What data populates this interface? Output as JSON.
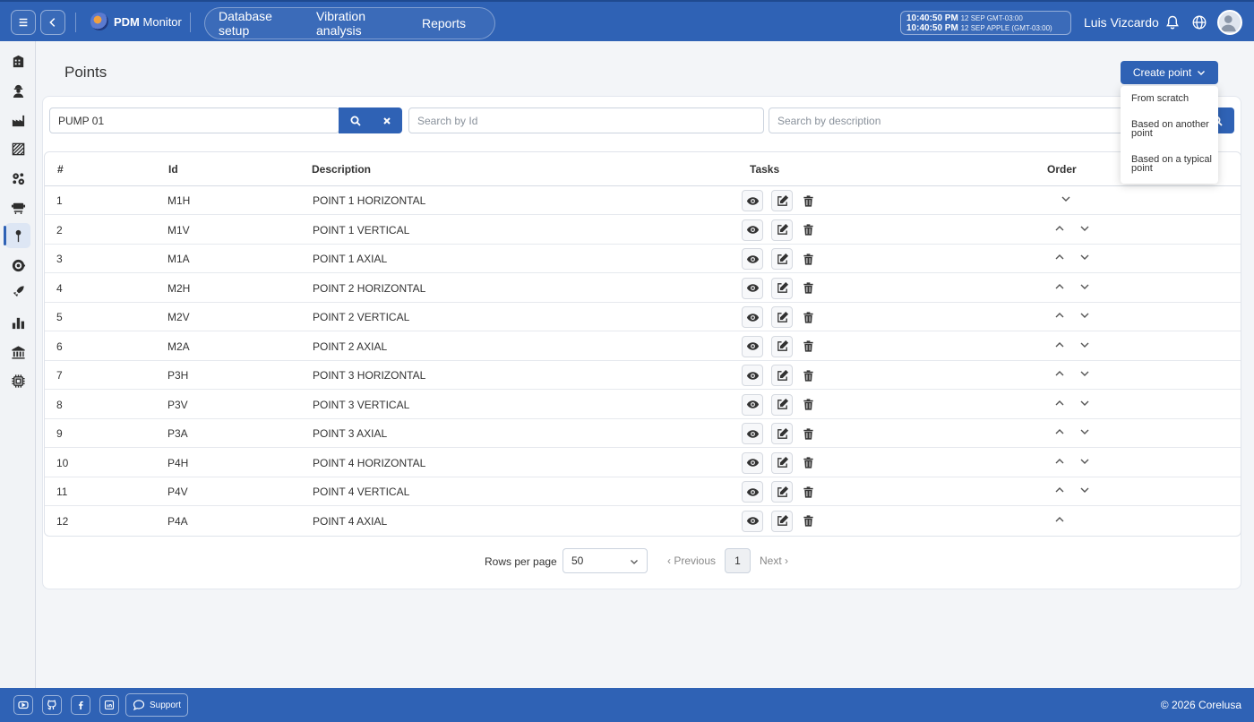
{
  "header": {
    "app_name_bold": "PDM",
    "app_name_rest": "Monitor",
    "nav": [
      "Database setup",
      "Vibration analysis",
      "Reports"
    ],
    "clock": {
      "line1_time": "10:40:50 PM",
      "line1_tz": "12 SEP  GMT-03:00",
      "line2_time": "10:40:50 PM",
      "line2_tz": "12 SEP  APPLE (GMT-03:00)"
    },
    "user_name": "Luis Vizcardo"
  },
  "sidebar": {
    "icons": [
      "building-icon",
      "worker-icon",
      "factory-icon",
      "area-icon",
      "gears-icon",
      "machine-icon",
      "point-pin-icon",
      "component-icon",
      "rocket-icon",
      "bar-chart-icon",
      "bank-icon",
      "chip-icon"
    ],
    "active_index": 6
  },
  "page": {
    "title": "Points",
    "create_button": "Create point",
    "create_menu": [
      "From scratch",
      "Based on another point",
      "Based on a typical point"
    ]
  },
  "filters": {
    "asset_value": "PUMP 01",
    "id_placeholder": "Search by Id",
    "description_placeholder": "Search by description"
  },
  "table": {
    "columns": [
      "#",
      "Id",
      "Description",
      "Tasks",
      "Order"
    ],
    "rows": [
      {
        "n": "1",
        "id": "M1H",
        "desc": "POINT 1 HORIZONTAL",
        "up": false,
        "down": true
      },
      {
        "n": "2",
        "id": "M1V",
        "desc": "POINT 1 VERTICAL",
        "up": true,
        "down": true
      },
      {
        "n": "3",
        "id": "M1A",
        "desc": "POINT 1 AXIAL",
        "up": true,
        "down": true
      },
      {
        "n": "4",
        "id": "M2H",
        "desc": "POINT 2 HORIZONTAL",
        "up": true,
        "down": true
      },
      {
        "n": "5",
        "id": "M2V",
        "desc": "POINT 2 VERTICAL",
        "up": true,
        "down": true
      },
      {
        "n": "6",
        "id": "M2A",
        "desc": "POINT 2 AXIAL",
        "up": true,
        "down": true
      },
      {
        "n": "7",
        "id": "P3H",
        "desc": "POINT 3 HORIZONTAL",
        "up": true,
        "down": true
      },
      {
        "n": "8",
        "id": "P3V",
        "desc": "POINT 3 VERTICAL",
        "up": true,
        "down": true
      },
      {
        "n": "9",
        "id": "P3A",
        "desc": "POINT 3 AXIAL",
        "up": true,
        "down": true
      },
      {
        "n": "10",
        "id": "P4H",
        "desc": "POINT 4 HORIZONTAL",
        "up": true,
        "down": true
      },
      {
        "n": "11",
        "id": "P4V",
        "desc": "POINT 4 VERTICAL",
        "up": true,
        "down": true
      },
      {
        "n": "12",
        "id": "P4A",
        "desc": "POINT 4 AXIAL",
        "up": true,
        "down": false
      }
    ]
  },
  "pagination": {
    "rows_label": "Rows per page",
    "rows_value": "50",
    "previous": "Previous",
    "page": "1",
    "next": "Next"
  },
  "footer": {
    "support": "Support",
    "copyright": "© 2026 Corelusa"
  },
  "colors": {
    "primary": "#2f62b5",
    "background": "#f3f5f8"
  }
}
